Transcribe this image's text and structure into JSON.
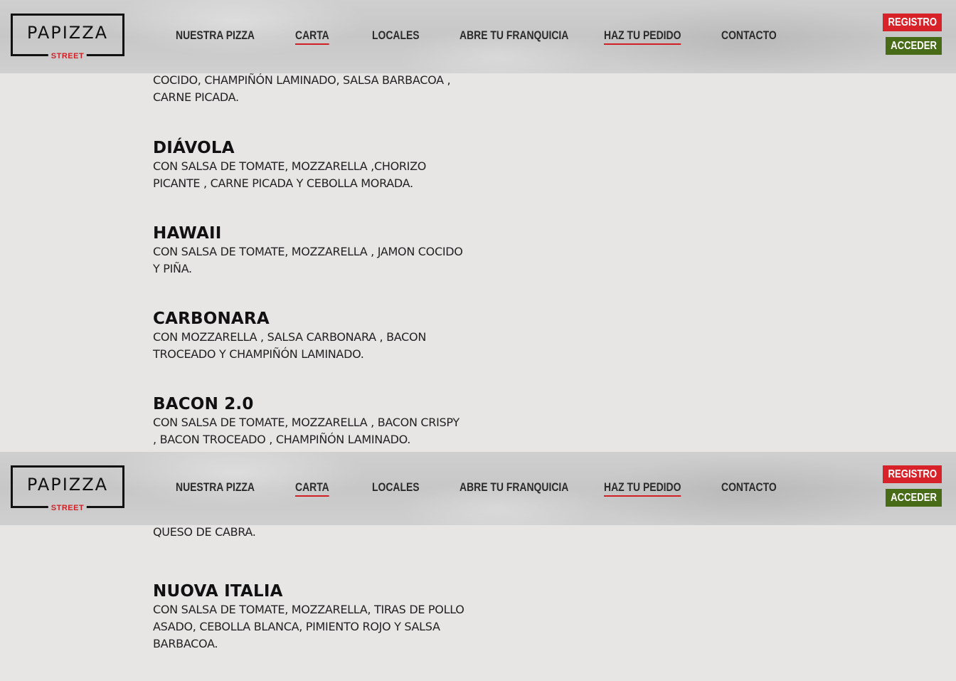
{
  "header": {
    "logo_main": "PAPIZZA",
    "logo_sub": "STREET",
    "nav": [
      "NUESTRA PIZZA",
      "CARTA",
      "LOCALES",
      "ABRE TU FRANQUICIA",
      "HAZ TU PEDIDO",
      "CONTACTO"
    ],
    "registro_label": "REGISTRO",
    "acceder_label": "ACCEDER"
  },
  "section1": {
    "partial_top_desc": "COCIDO, CHAMPIÑÓN LAMINADO, SALSA BARBACOA , CARNE PICADA.",
    "pizzas": [
      {
        "name": "DIÁVOLA",
        "desc": "CON SALSA DE TOMATE, MOZZARELLA ,CHORIZO PICANTE , CARNE PICADA Y CEBOLLA MORADA."
      },
      {
        "name": "HAWAII",
        "desc": "CON SALSA DE TOMATE, MOZZARELLA , JAMON COCIDO Y PIÑA."
      },
      {
        "name": "CARBONARA",
        "desc": "CON MOZZARELLA , SALSA CARBONARA , BACON TROCEADO Y CHAMPIÑÓN LAMINADO."
      },
      {
        "name": "BACON 2.0",
        "desc": "CON SALSA DE TOMATE, MOZZARELLA , BACON CRISPY , BACON TROCEADO , CHAMPIÑÓN LAMINADO."
      }
    ]
  },
  "section2": {
    "partial_top_desc": "CON MOZZARELLA , SALSA DE QUESO , QUESO AZUL Y QUESO DE CABRA.",
    "pizzas": [
      {
        "name": "NUOVA ITALIA",
        "desc": "CON SALSA DE TOMATE, MOZZARELLA, TIRAS DE POLLO ASADO, CEBOLLA BLANCA, PIMIENTO ROJO Y SALSA BARBACOA."
      }
    ]
  },
  "colors": {
    "accent_red": "#d8222a",
    "accent_green": "#476b17",
    "background": "#e8e6e5"
  }
}
